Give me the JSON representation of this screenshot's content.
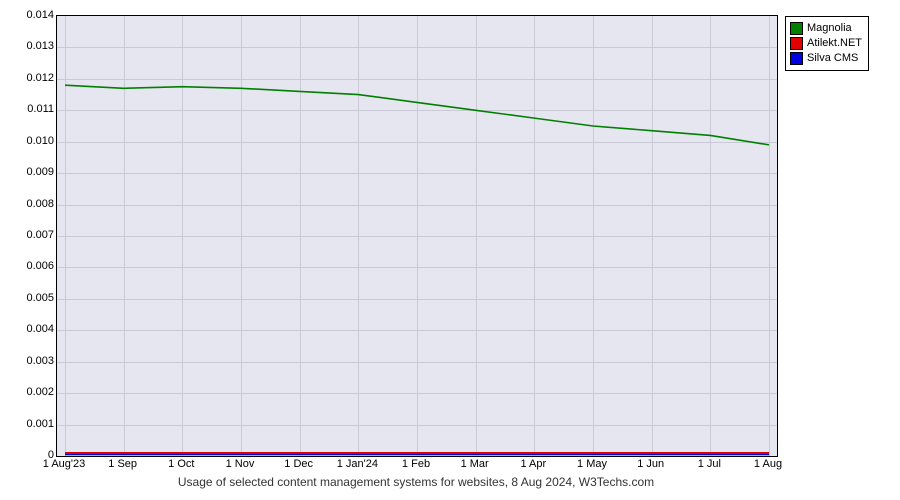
{
  "chart_data": {
    "type": "line",
    "title": "Usage of selected content management systems for websites, 8 Aug 2024, W3Techs.com",
    "xlabel": "",
    "ylabel": "",
    "ylim": [
      0,
      0.014
    ],
    "y_ticks": [
      0,
      0.001,
      0.002,
      0.003,
      0.004,
      0.005,
      0.006,
      0.007,
      0.008,
      0.009,
      0.01,
      0.011,
      0.012,
      0.013,
      0.014
    ],
    "categories": [
      "1 Aug'23",
      "1 Sep",
      "1 Oct",
      "1 Nov",
      "1 Dec",
      "1 Jan'24",
      "1 Feb",
      "1 Mar",
      "1 Apr",
      "1 May",
      "1 Jun",
      "1 Jul",
      "1 Aug"
    ],
    "series": [
      {
        "name": "Magnolia",
        "color": "#008000",
        "values": [
          0.0118,
          0.0117,
          0.01175,
          0.0117,
          0.0116,
          0.0115,
          0.01125,
          0.011,
          0.01075,
          0.0105,
          0.01035,
          0.0102,
          0.0099
        ]
      },
      {
        "name": "Atilekt.NET",
        "color": "#e00000",
        "values": [
          0.0001,
          0.0001,
          0.0001,
          0.0001,
          0.0001,
          0.0001,
          0.0001,
          0.0001,
          0.0001,
          0.0001,
          0.0001,
          0.0001,
          0.0001
        ]
      },
      {
        "name": "Silva CMS",
        "color": "#0000e0",
        "values": [
          5e-05,
          5e-05,
          5e-05,
          5e-05,
          5e-05,
          5e-05,
          5e-05,
          5e-05,
          5e-05,
          5e-05,
          5e-05,
          5e-05,
          5e-05
        ]
      }
    ],
    "legend_position": "right",
    "grid": true
  }
}
